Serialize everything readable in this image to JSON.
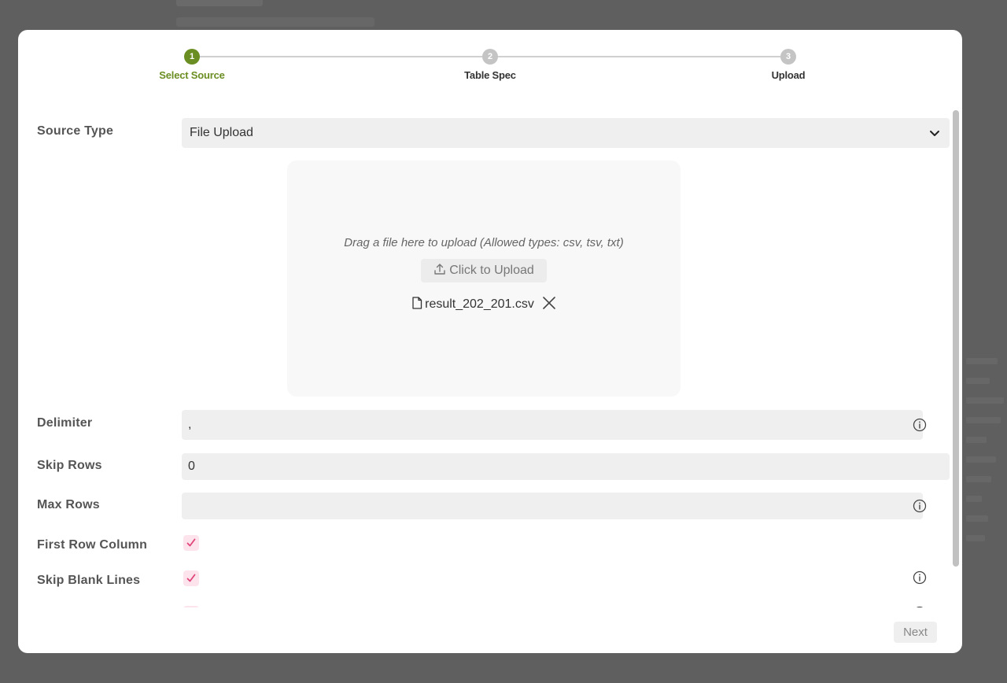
{
  "stepper": {
    "steps": [
      {
        "number": "1",
        "label": "Select Source",
        "state": "active"
      },
      {
        "number": "2",
        "label": "Table Spec",
        "state": "inactive"
      },
      {
        "number": "3",
        "label": "Upload",
        "state": "inactive"
      }
    ]
  },
  "form": {
    "source_type": {
      "label": "Source Type",
      "value": "File Upload"
    },
    "dropzone": {
      "hint": "Drag a file here to upload (Allowed types: csv, tsv, txt)",
      "upload_label": "Click to Upload",
      "file_name": "result_202_201.csv"
    },
    "delimiter": {
      "label": "Delimiter",
      "value": ","
    },
    "skip_rows": {
      "label": "Skip Rows",
      "value": "0"
    },
    "max_rows": {
      "label": "Max Rows",
      "value": ""
    },
    "first_row_column": {
      "label": "First Row Column",
      "checked": true
    },
    "skip_blank_lines": {
      "label": "Skip Blank Lines",
      "checked": true
    }
  },
  "footer": {
    "next_label": "Next"
  },
  "colors": {
    "accent": "#6b8e23",
    "checkbox_bg": "#fde4ec",
    "checkmark": "#e0457b"
  },
  "icons": [
    "chevron-down-icon",
    "upload-icon",
    "file-icon",
    "close-icon",
    "info-icon",
    "check-icon"
  ]
}
